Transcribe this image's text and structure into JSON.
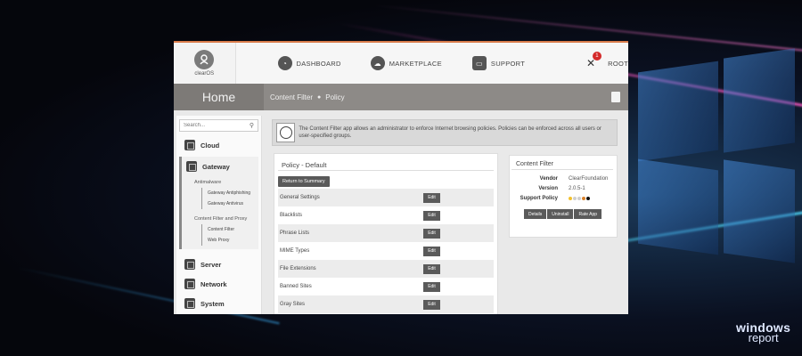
{
  "app": {
    "logo_text": "clearOS"
  },
  "nav": {
    "items": [
      {
        "label": "DASHBOARD",
        "icon": "speedometer-icon"
      },
      {
        "label": "MARKETPLACE",
        "icon": "cloud-download-icon"
      },
      {
        "label": "SUPPORT",
        "icon": "inbox-icon"
      },
      {
        "label": "ROOT",
        "icon": "tools-icon",
        "badge": "1"
      }
    ]
  },
  "header": {
    "home_title": "Home",
    "breadcrumb": [
      "Content Filter",
      "Policy"
    ]
  },
  "sidebar": {
    "search_placeholder": "Search...",
    "categories": {
      "cloud": "Cloud",
      "gateway": "Gateway",
      "server": "Server",
      "network": "Network",
      "system": "System"
    },
    "gateway_sections": {
      "antimalware": "Antimalware",
      "antiphishing": "Gateway Antiphishing",
      "antivirus": "Gateway Antivirus",
      "content_filter_and_proxy": "Content Filter and Proxy",
      "content_filter": "Content Filter",
      "web_proxy": "Web Proxy"
    }
  },
  "info": {
    "text": "The Content Filter app allows an administrator to enforce Internet browsing policies. Policies can be enforced across all users or user-specified groups."
  },
  "policy": {
    "title": "Policy - Default",
    "return_label": "Return to Summary",
    "edit_label": "Edit",
    "rows": [
      "General Settings",
      "Blacklists",
      "Phrase Lists",
      "MIME Types",
      "File Extensions",
      "Banned Sites",
      "Gray Sites"
    ]
  },
  "content_filter_card": {
    "title": "Content Filter",
    "vendor_label": "Vendor",
    "vendor": "ClearFoundation",
    "version_label": "Version",
    "version": "2.0.5-1",
    "support_label": "Support Policy",
    "support_colors": [
      "#f2c12e",
      "#cfcfcf",
      "#cfcfcf",
      "#d9822b",
      "#111111"
    ],
    "buttons": [
      "Details",
      "Uninstall",
      "Rate App"
    ]
  },
  "watermark": {
    "line1": "windows",
    "line2": "report"
  },
  "colors": {
    "accent_bar": "#d97b4a",
    "title_bar": "#8d8a87",
    "button": "#5a5a5a",
    "badge": "#d42a2a"
  }
}
